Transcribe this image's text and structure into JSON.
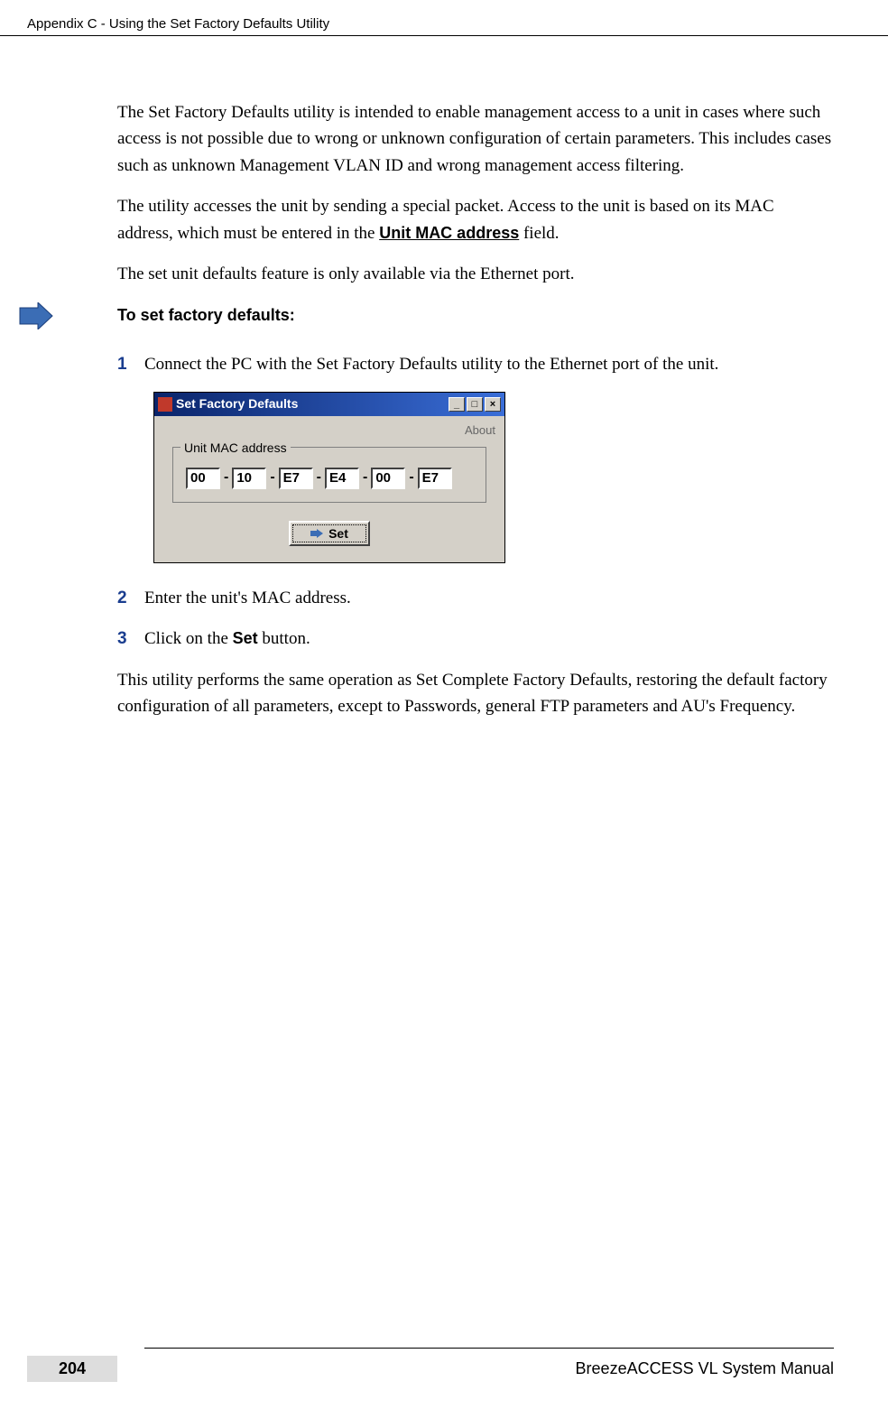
{
  "header": {
    "title": "Appendix C - Using the Set Factory Defaults Utility"
  },
  "body": {
    "para1": "The Set Factory Defaults utility is intended to enable management access to a unit in cases where such access is not possible due to wrong or unknown configuration of certain parameters. This includes cases such as unknown Management VLAN ID and wrong management access filtering.",
    "para2_pre": "The utility accesses the unit by sending a special packet. Access to the unit is based on its MAC address, which must be entered in the ",
    "para2_bold": "Unit MAC address",
    "para2_post": " field.",
    "para3": "The set unit defaults feature is only available via the Ethernet port.",
    "procedure_title": "To set factory defaults:",
    "steps": [
      {
        "num": "1",
        "text": " Connect the PC with the Set Factory Defaults utility to the Ethernet port of the unit."
      },
      {
        "num": "2",
        "text": "Enter the unit's MAC address."
      },
      {
        "num": "3",
        "pre": "Click on the ",
        "bold": "Set",
        "post": " button."
      }
    ],
    "para4": "This utility performs the same operation as Set Complete Factory Defaults, restoring the default factory configuration of all parameters, except to Passwords, general FTP parameters and AU's Frequency."
  },
  "screenshot": {
    "title": "Set Factory Defaults",
    "about": "About",
    "legend": "Unit MAC address",
    "mac": [
      "00",
      "10",
      "E7",
      "E4",
      "00",
      "E7"
    ],
    "set_label": "Set",
    "win_min": "_",
    "win_max": "□",
    "win_close": "×"
  },
  "footer": {
    "page": "204",
    "manual": "BreezeACCESS VL System Manual"
  }
}
